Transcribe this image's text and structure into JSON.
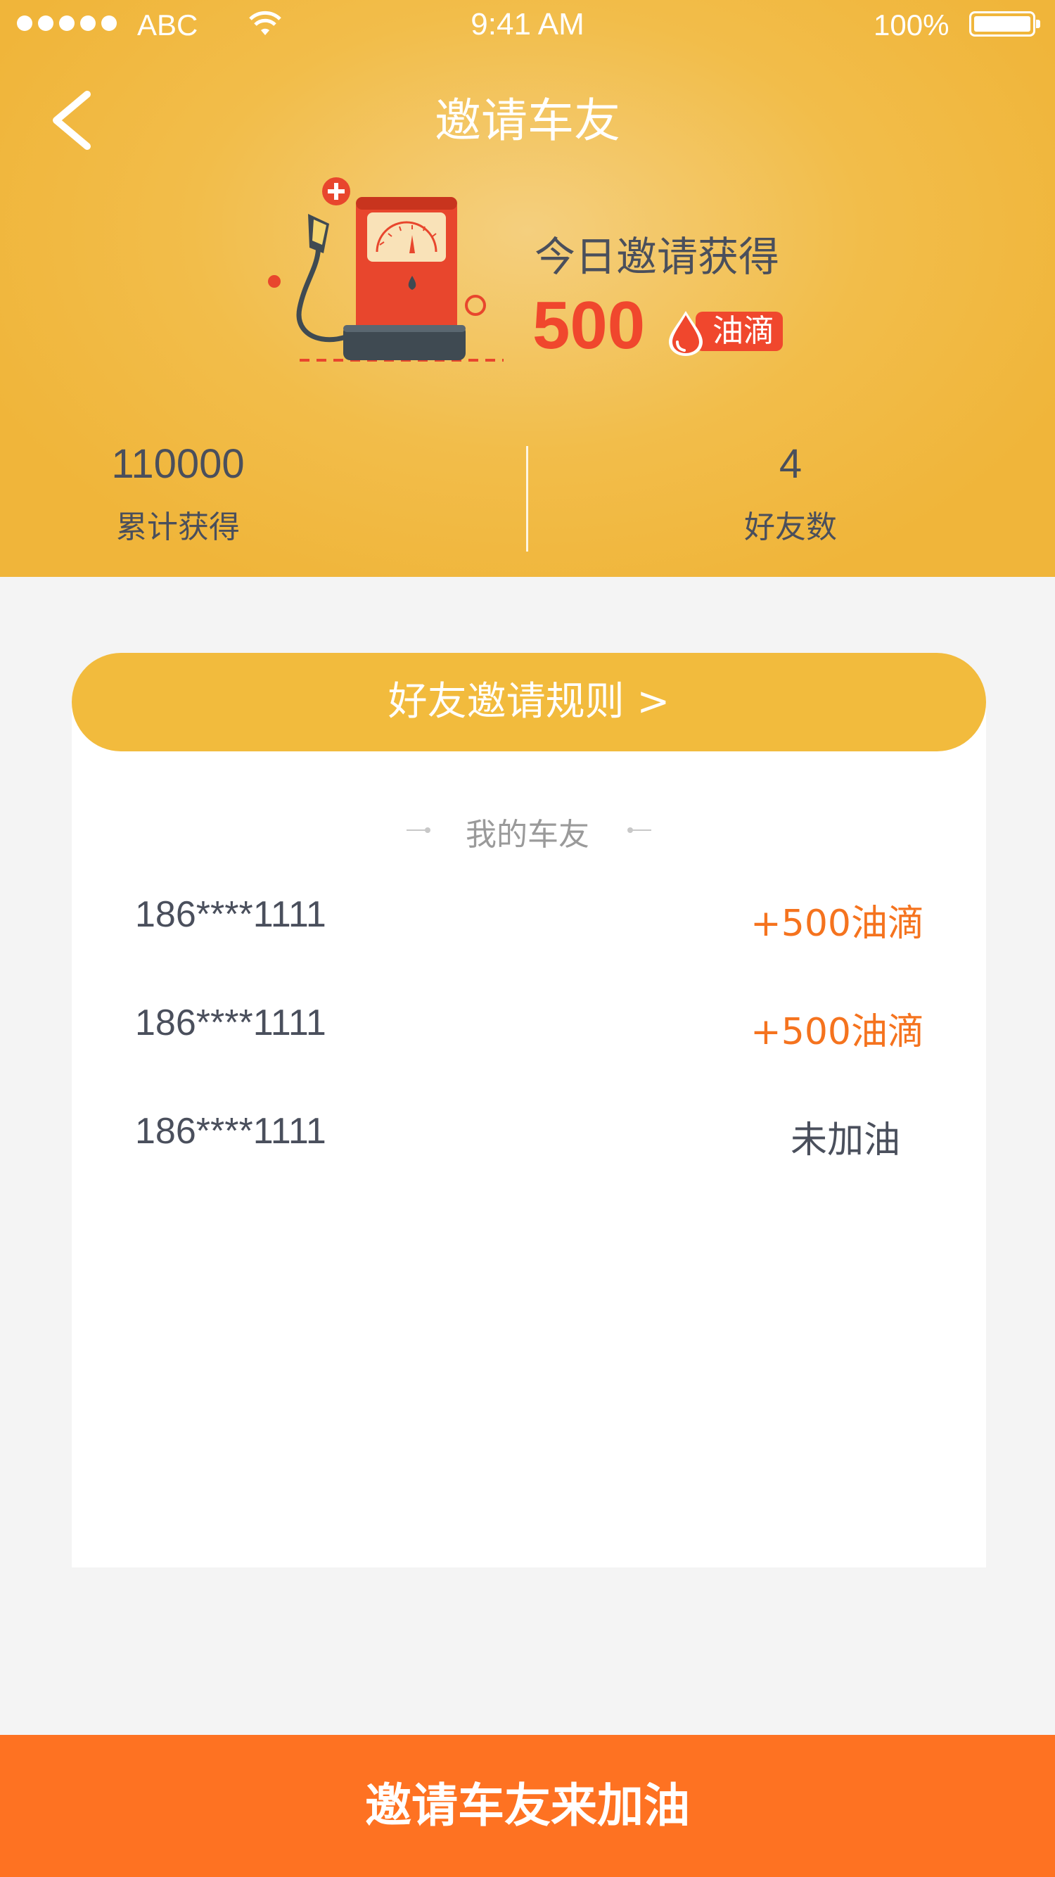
{
  "status_bar": {
    "carrier": "ABC",
    "time": "9:41 AM",
    "battery": "100%"
  },
  "header": {
    "title": "邀请车友",
    "today_label": "今日邀请获得",
    "today_value": "500",
    "unit_badge": "油滴"
  },
  "stats": {
    "total_value": "110000",
    "total_label": "累计获得",
    "friends_value": "4",
    "friends_label": "好友数"
  },
  "rules_button": "好友邀请规则 >",
  "section_title": "我的车友",
  "friends": [
    {
      "phone": "186****1111",
      "status": "+500油滴"
    },
    {
      "phone": "186****1111",
      "status": "+500油滴"
    },
    {
      "phone": "186****1111",
      "status": "未加油"
    }
  ],
  "invite_button": "邀请车友来加油",
  "colors": {
    "header": "#f2bd4a",
    "rules_button": "#f2bb3d",
    "accent_red": "#f0472d",
    "accent_orange": "#f5731e",
    "cta": "#fe7222"
  }
}
